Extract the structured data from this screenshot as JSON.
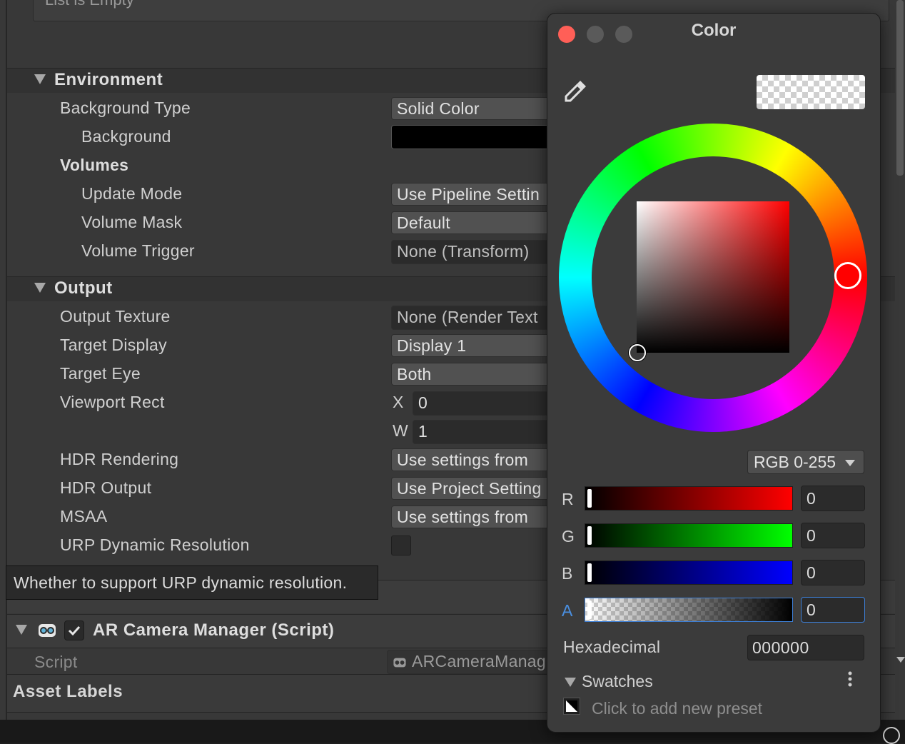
{
  "inspector": {
    "list_empty": "List is Empty",
    "environment": {
      "title": "Environment",
      "background_type_label": "Background Type",
      "background_type_value": "Solid Color",
      "background_label": "Background",
      "volumes_label": "Volumes",
      "update_mode_label": "Update Mode",
      "update_mode_value": "Use Pipeline Settin",
      "volume_mask_label": "Volume Mask",
      "volume_mask_value": "Default",
      "volume_trigger_label": "Volume Trigger",
      "volume_trigger_value": "None (Transform)"
    },
    "output": {
      "title": "Output",
      "output_texture_label": "Output Texture",
      "output_texture_value": "None (Render Text",
      "target_display_label": "Target Display",
      "target_display_value": "Display 1",
      "target_eye_label": "Target Eye",
      "target_eye_value": "Both",
      "viewport_rect_label": "Viewport Rect",
      "viewport_x_label": "X",
      "viewport_x_value": "0",
      "viewport_w_label": "W",
      "viewport_w_value": "1",
      "hdr_rendering_label": "HDR Rendering",
      "hdr_rendering_value": "Use settings from",
      "hdr_output_label": "HDR Output",
      "hdr_output_value": "Use Project Setting",
      "msaa_label": "MSAA",
      "msaa_value": "Use settings from",
      "urp_dynamic_label": "URP Dynamic Resolution"
    },
    "tooltip": "Whether to support URP dynamic resolution.",
    "ar_camera_manager": {
      "title": "AR Camera Manager (Script)",
      "script_label": "Script",
      "script_value": "ARCameraManag"
    },
    "asset_labels": "Asset Labels"
  },
  "color_picker": {
    "title": "Color",
    "mode": "RGB 0-255",
    "channels": [
      {
        "label": "R",
        "value": "0"
      },
      {
        "label": "G",
        "value": "0"
      },
      {
        "label": "B",
        "value": "0"
      },
      {
        "label": "A",
        "value": "0"
      }
    ],
    "hex_label": "Hexadecimal",
    "hex_value": "000000",
    "swatches_label": "Swatches",
    "add_preset": "Click to add new preset",
    "colors": {
      "close": "#ff5f57",
      "accent_focus": "#3d7fd6",
      "alpha_label": "#4a8fe0"
    }
  }
}
